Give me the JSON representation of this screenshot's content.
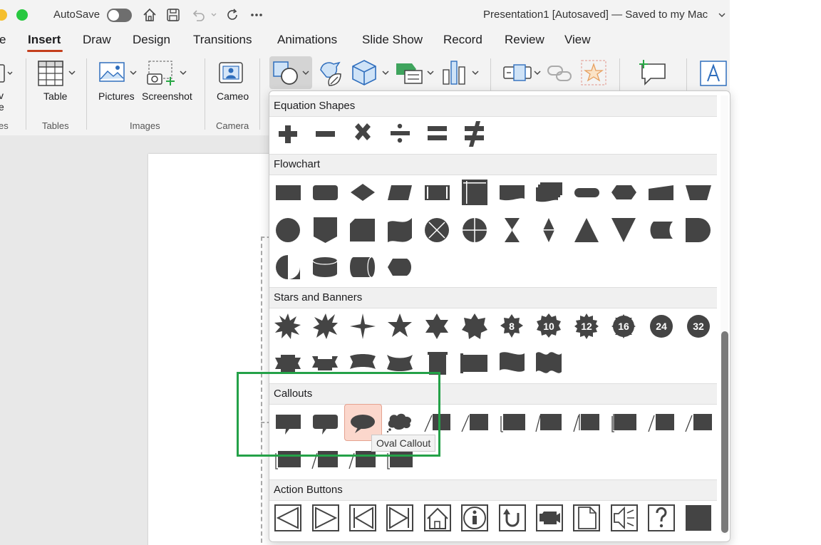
{
  "titlebar": {
    "autosave_label": "AutoSave",
    "doc_title": "Presentation1 [Autosaved] — Saved to my Mac",
    "title_chevron": "⌄"
  },
  "tabs": [
    {
      "label": "e"
    },
    {
      "label": "Insert"
    },
    {
      "label": "Draw"
    },
    {
      "label": "Design"
    },
    {
      "label": "Transitions"
    },
    {
      "label": "Animations"
    },
    {
      "label": "Slide Show"
    },
    {
      "label": "Record"
    },
    {
      "label": "Review"
    },
    {
      "label": "View"
    }
  ],
  "ribbon": {
    "partial_label_1": "v",
    "partial_label_2": "e",
    "partial_group": "es",
    "table_label": "Table",
    "pictures_label": "Pictures",
    "screenshot_label": "Screenshot",
    "cameo_label": "Cameo",
    "group_tables": "Tables",
    "group_images": "Images",
    "group_camera": "Camera"
  },
  "gallery": {
    "sections": [
      {
        "title": "Equation Shapes"
      },
      {
        "title": "Flowchart"
      },
      {
        "title": "Stars and Banners"
      },
      {
        "title": "Callouts"
      },
      {
        "title": "Action Buttons"
      }
    ],
    "star_numbers": [
      "8",
      "10",
      "12",
      "16",
      "24",
      "32"
    ],
    "tooltip": "Oval Callout"
  },
  "colors": {
    "accent": "#c43e1c",
    "shape_fill": "#444444",
    "highlight": "#24a148",
    "selected_bg": "#fbd7cc"
  }
}
